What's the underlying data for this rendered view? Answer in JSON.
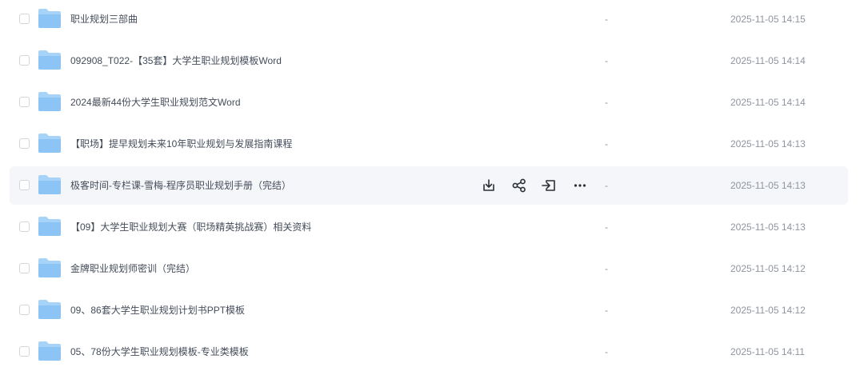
{
  "rows": [
    {
      "name": "职业规划三部曲",
      "size": "-",
      "time": "2025-11-05 14:15"
    },
    {
      "name": "092908_T022-【35套】大学生职业规划模板Word",
      "size": "-",
      "time": "2025-11-05 14:14"
    },
    {
      "name": "2024最新44份大学生职业规划范文Word",
      "size": "-",
      "time": "2025-11-05 14:14"
    },
    {
      "name": "【职场】提早规划未来10年职业规划与发展指南课程",
      "size": "-",
      "time": "2025-11-05 14:13"
    },
    {
      "name": "极客时间-专栏课-雪梅-程序员职业规划手册（完结）",
      "size": "-",
      "time": "2025-11-05 14:13"
    },
    {
      "name": "【09】大学生职业规划大赛（职场精英挑战赛）相关资料",
      "size": "-",
      "time": "2025-11-05 14:13"
    },
    {
      "name": "金牌职业规划师密训（完结）",
      "size": "-",
      "time": "2025-11-05 14:12"
    },
    {
      "name": "09、86套大学生职业规划计划书PPT模板",
      "size": "-",
      "time": "2025-11-05 14:12"
    },
    {
      "name": "05、78份大学生职业规划模板-专业类模板",
      "size": "-",
      "time": "2025-11-05 14:11"
    }
  ],
  "hovered_row_index": 4,
  "row_actions": [
    "download-icon",
    "share-icon",
    "move-icon",
    "more-icon"
  ],
  "colors": {
    "folder_body": "#a8d3f8",
    "folder_front": "#8cc5f5",
    "hover_bg": "#f5f6f9",
    "text": "#454d5a",
    "muted": "#8f959e"
  }
}
